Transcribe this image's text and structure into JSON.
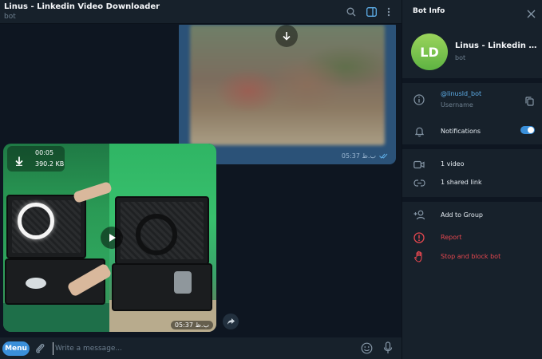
{
  "chat": {
    "title": "Linus - Linkedin Video Downloader",
    "subtitle": "bot"
  },
  "messages": {
    "outgoing_video": {
      "time": "05:37 ب.ظ"
    },
    "incoming_video": {
      "duration": "00:05",
      "size": "390.2 KB",
      "time": "05:37 ب.ظ"
    }
  },
  "composer": {
    "menu_label": "Menu",
    "placeholder": "Write a message..."
  },
  "panel": {
    "title": "Bot Info",
    "avatar_initials": "LD",
    "bot_name": "Linus - Linkedin Video Downloader",
    "bot_kind": "bot",
    "username": "@linusld_bot",
    "username_label": "Username",
    "notifications_label": "Notifications",
    "notifications_on": true,
    "videos_label": "1 video",
    "links_label": "1 shared link",
    "add_to_group": "Add to Group",
    "report": "Report",
    "stop_block": "Stop and block bot"
  },
  "colors": {
    "accent": "#3a8fd9",
    "danger": "#e5474f",
    "link": "#5eaee8",
    "avatar": "#7cc44f"
  },
  "icons": {
    "header": [
      "search-icon",
      "sidebar-toggle-icon",
      "more-vertical-icon"
    ],
    "panel": [
      "close-icon",
      "info-icon",
      "copy-icon",
      "bell-icon",
      "video-icon",
      "link-icon",
      "add-user-icon",
      "report-icon",
      "hand-stop-icon"
    ],
    "composer": [
      "paperclip-icon",
      "emoji-icon",
      "microphone-icon"
    ]
  }
}
